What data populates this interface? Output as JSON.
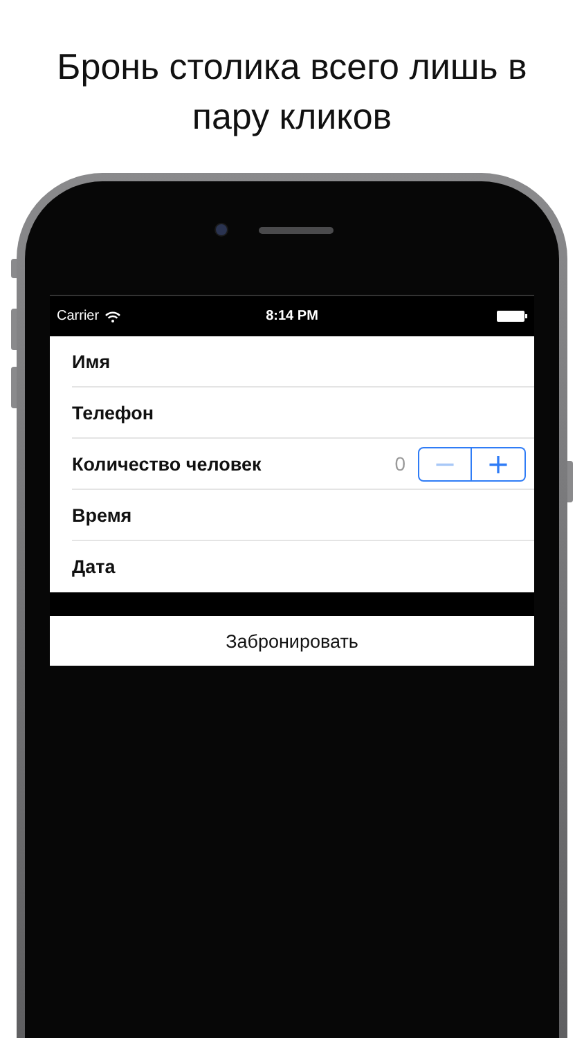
{
  "headline": "Бронь столика всего лишь в пару кликов",
  "status_bar": {
    "carrier": "Carrier",
    "time": "8:14 PM"
  },
  "form": {
    "rows": [
      {
        "kind": "text",
        "label": "Имя"
      },
      {
        "kind": "text",
        "label": "Телефон"
      },
      {
        "kind": "stepper",
        "label": "Количество человек",
        "value": "0",
        "minus": {
          "symbol": "−",
          "disabled": true
        },
        "plus": {
          "symbol": "+",
          "disabled": false
        }
      },
      {
        "kind": "text",
        "label": "Время"
      },
      {
        "kind": "text",
        "label": "Дата"
      }
    ]
  },
  "submit_button": {
    "label": "Забронировать"
  }
}
